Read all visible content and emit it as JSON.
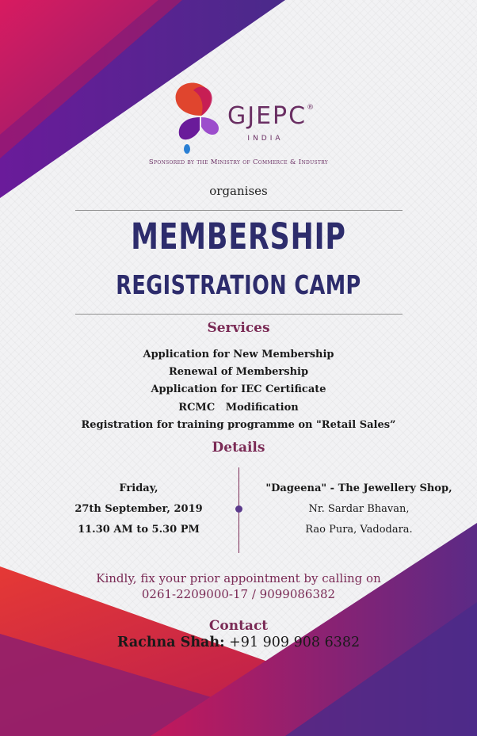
{
  "brand": {
    "name": "GJEPC",
    "registered_mark": "®",
    "country": "INDIA",
    "sponsor": "Sponsored by the Ministry of Commerce & Industry"
  },
  "intro": "organises",
  "title": {
    "line1": "MEMBERSHIP",
    "line2": "REGISTRATION CAMP"
  },
  "services": {
    "heading": "Services",
    "items": [
      "Application for New Membership",
      "Renewal of Membership",
      "Application for IEC Certificate",
      "RCMC   Modification",
      "Registration for training programme on \"Retail Sales”"
    ]
  },
  "details": {
    "heading": "Details",
    "day": "Friday,",
    "date": "27th September, 2019",
    "time": "11.30 AM to 5.30 PM",
    "venue": "\"Dageena\" - The Jewellery Shop,",
    "address_line1": "Nr. Sardar Bhavan,",
    "address_line2": "Rao Pura, Vadodara."
  },
  "appointment": {
    "line1": "Kindly, fix your prior appointment by calling on",
    "line2": "0261-2209000-17 / 9099086382"
  },
  "contact": {
    "heading": "Contact",
    "name": "Rachna Shah:",
    "phone": " +91 909 908 6382"
  },
  "colors": {
    "title": "#2d2c6c",
    "accent": "#7a2a55",
    "magenta": "#c2185b",
    "purple": "#5b2a86"
  }
}
